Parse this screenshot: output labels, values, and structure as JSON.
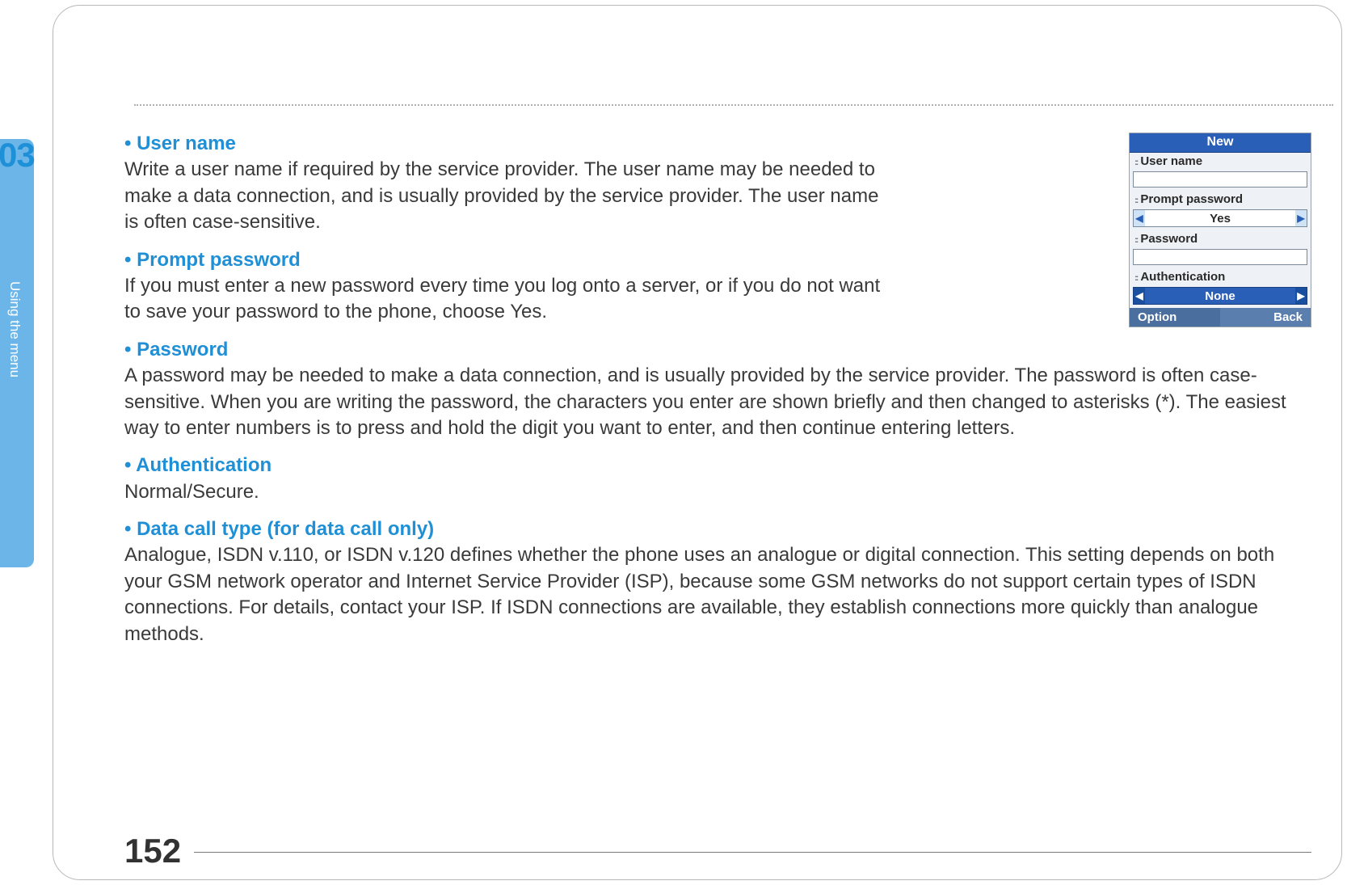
{
  "chapter": {
    "number": "03",
    "title": "Using the menu"
  },
  "page_number": "152",
  "sections": [
    {
      "title": "• User name",
      "body": "Write a user name if required by the service provider. The user name may be needed to make a data connection, and is usually provided by the service provider. The user name is often case-sensitive.",
      "narrow": true
    },
    {
      "title": "• Prompt password",
      "body": "If you must enter a new password every time you log onto a server, or if you do not want to save your password to the phone, choose Yes.",
      "narrow": true
    },
    {
      "title": "• Password",
      "body": "A password may be needed to make a data connection, and is usually provided by the service provider. The password is often case-sensitive. When you are writing the password, the characters you enter are shown briefly and then changed to asterisks (*). The easiest way to enter numbers is to press and hold the digit you want to enter, and then continue entering letters.",
      "narrow": false
    },
    {
      "title": "• Authentication",
      "body": "Normal/Secure.",
      "narrow": false
    },
    {
      "title": "• Data call type (for data call only)",
      "body": "Analogue, ISDN v.110, or ISDN v.120 defines whether the phone uses an analogue or digital connection. This setting depends on both your GSM network operator and Internet Service Provider (ISP), because some GSM networks do not support certain types of ISDN connections. For details, contact your ISP. If ISDN connections are available, they establish connections more quickly than analogue methods.",
      "narrow": false
    }
  ],
  "phone": {
    "title": "New",
    "labels": {
      "username": "User name",
      "prompt_password": "Prompt password",
      "password": "Password",
      "authentication": "Authentication"
    },
    "values": {
      "prompt_password": "Yes",
      "authentication": "None"
    },
    "softkeys": {
      "left": "Option",
      "right": "Back"
    }
  }
}
